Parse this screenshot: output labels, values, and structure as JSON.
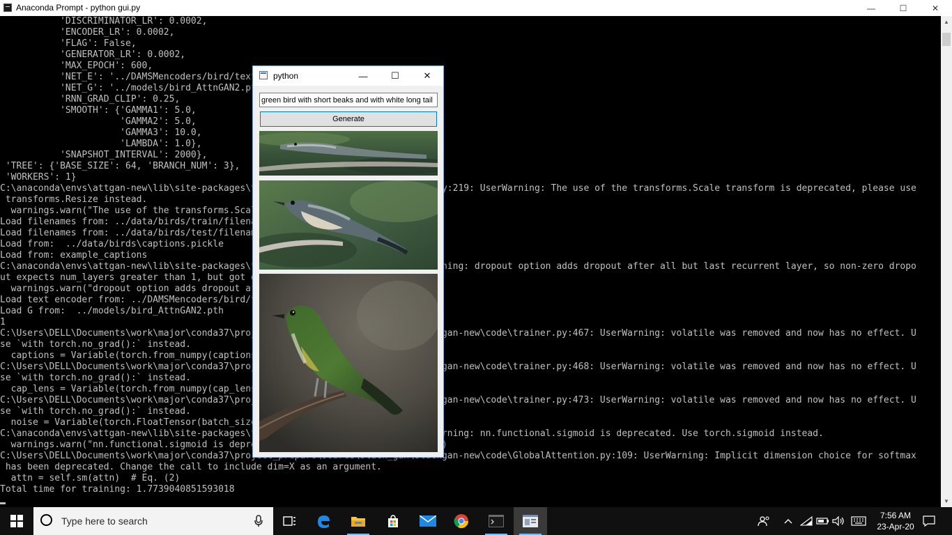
{
  "console_window": {
    "title": "Anaconda Prompt - python  gui.py",
    "controls": {
      "minimize": "—",
      "maximize": "☐",
      "close": "✕"
    },
    "lines": [
      "           'DISCRIMINATOR_LR': 0.0002,",
      "           'ENCODER_LR': 0.0002,",
      "           'FLAG': False,",
      "           'GENERATOR_LR': 0.0002,",
      "           'MAX_EPOCH': 600,",
      "           'NET_E': '../DAMSMencoders/bird/text_encoder200.pth',",
      "           'NET_G': '../models/bird_AttnGAN2.pth',",
      "           'RNN_GRAD_CLIP': 0.25,",
      "           'SMOOTH': {'GAMMA1': 5.0,",
      "                      'GAMMA2': 5.0,",
      "                      'GAMMA3': 10.0,",
      "                      'LAMBDA': 1.0},",
      "           'SNAPSHOT_INTERVAL': 2000},",
      " 'TREE': {'BASE_SIZE': 64, 'BRANCH_NUM': 3},",
      " 'WORKERS': 1}",
      "C:\\anaconda\\envs\\attgan-new\\lib\\site-packages\\torchvision\\transforms\\transforms.py:219: UserWarning: The use of the transforms.Scale transform is deprecated, please use",
      " transforms.Resize instead.",
      "  warnings.warn(\"The use of the transforms.Scale transform is deprecated, \" +",
      "Load filenames from: ../data/birds/train/filenames.pickle (8855)",
      "Load filenames from: ../data/birds/test/filenames.pickle (2933)",
      "Load from:  ../data/birds\\captions.pickle",
      "Load from: example_captions",
      "C:\\anaconda\\envs\\attgan-new\\lib\\site-packages\\torch\\nn\\modules\\rnn.py:50: UserWarning: dropout option adds dropout after all but last recurrent layer, so non-zero dropo",
      "ut expects num_layers greater than 1, but got dropout=0.5 and num_layers=1",
      "  warnings.warn(\"dropout option adds dropout after all but last \"",
      "Load text encoder from: ../DAMSMencoders/bird/text_encoder200.pth",
      "Load G from:  ../models/bird_AttnGAN2.pth",
      "1",
      "C:\\Users\\DELL\\Documents\\work\\major\\conda37\\project_prepare\\source\\stack_gan\\stackgan-new\\code\\trainer.py:467: UserWarning: volatile was removed and now has no effect. U",
      "se `with torch.no_grad():` instead.",
      "  captions = Variable(torch.from_numpy(captions), volatile=True)",
      "C:\\Users\\DELL\\Documents\\work\\major\\conda37\\project_prepare\\source\\stack_gan\\stackgan-new\\code\\trainer.py:468: UserWarning: volatile was removed and now has no effect. U",
      "se `with torch.no_grad():` instead.",
      "  cap_lens = Variable(torch.from_numpy(cap_lens), volatile=True)",
      "C:\\Users\\DELL\\Documents\\work\\major\\conda37\\project_prepare\\source\\stack_gan\\stackgan-new\\code\\trainer.py:473: UserWarning: volatile was removed and now has no effect. U",
      "se `with torch.no_grad():` instead.",
      "  noise = Variable(torch.FloatTensor(batch_size, nz), volatile=True)",
      "C:\\anaconda\\envs\\attgan-new\\lib\\site-packages\\torch\\nn\\functional.py:1332: UserWarning: nn.functional.sigmoid is deprecated. Use torch.sigmoid instead.",
      "  warnings.warn(\"nn.functional.sigmoid is deprecated. Use torch.sigmoid instead.\")",
      "C:\\Users\\DELL\\Documents\\work\\major\\conda37\\project_prepare\\source\\stack_gan\\stackgan-new\\code\\GlobalAttention.py:109: UserWarning: Implicit dimension choice for softmax",
      " has been deprecated. Change the call to include dim=X as an argument.",
      "  attn = self.sm(attn)  # Eq. (2)",
      "Total time for training: 1.7739040851593018"
    ]
  },
  "python_window": {
    "title": "python",
    "controls": {
      "minimize": "—",
      "maximize": "☐",
      "close": "✕"
    },
    "prompt_value": "green bird with short beaks and with white long tail",
    "generate_label": "Generate",
    "images": [
      "bird-image-64",
      "bird-image-128",
      "bird-image-256"
    ]
  },
  "taskbar": {
    "search_placeholder": "Type here to search",
    "apps": [
      "task-view-icon",
      "edge-icon",
      "file-explorer-icon",
      "store-icon",
      "mail-icon",
      "chrome-icon",
      "terminal-icon",
      "python-app-icon"
    ],
    "active_app": "python-app-icon",
    "tray_icons": [
      "people-icon",
      "chevron-up-icon",
      "wifi-icon",
      "battery-icon",
      "volume-icon",
      "keyboard-icon"
    ],
    "time": "7:56 AM",
    "date": "23-Apr-20"
  },
  "colors": {
    "console_bg": "#000000",
    "console_fg": "#c0c0c0",
    "taskbar_bg": "#101010",
    "accent": "#0078d7"
  }
}
